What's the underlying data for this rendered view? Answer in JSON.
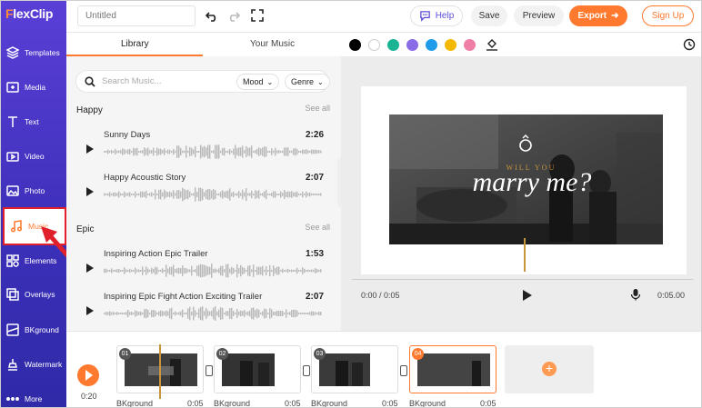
{
  "app": {
    "logo_pre": "F",
    "logo_rest": "lexClip"
  },
  "sidebar": {
    "items": [
      {
        "label": "Templates",
        "icon": "templates-icon"
      },
      {
        "label": "Media",
        "icon": "media-icon"
      },
      {
        "label": "Text",
        "icon": "text-icon"
      },
      {
        "label": "Video",
        "icon": "video-icon"
      },
      {
        "label": "Photo",
        "icon": "photo-icon"
      },
      {
        "label": "Music",
        "icon": "music-icon"
      },
      {
        "label": "Elements",
        "icon": "elements-icon"
      },
      {
        "label": "Overlays",
        "icon": "overlays-icon"
      },
      {
        "label": "BKground",
        "icon": "background-icon"
      },
      {
        "label": "Watermark",
        "icon": "watermark-icon"
      },
      {
        "label": "More",
        "icon": "more-icon"
      }
    ],
    "active": "Music"
  },
  "topbar": {
    "title_placeholder": "Untitled",
    "help": "Help",
    "save": "Save",
    "preview": "Preview",
    "export": "Export",
    "signup": "Sign Up"
  },
  "library": {
    "tabs": [
      "Library",
      "Your Music"
    ],
    "search_placeholder": "Search Music...",
    "mood": "Mood",
    "genre": "Genre",
    "sections": [
      {
        "title": "Happy",
        "see_all": "See all",
        "tracks": [
          {
            "name": "Sunny Days",
            "duration": "2:26"
          },
          {
            "name": "Happy Acoustic Story",
            "duration": "2:07"
          }
        ]
      },
      {
        "title": "Epic",
        "see_all": "See all",
        "tracks": [
          {
            "name": "Inspiring Action Epic Trailer",
            "duration": "1:53"
          },
          {
            "name": "Inspiring Epic Fight Action Exciting Trailer",
            "duration": "2:07"
          }
        ]
      }
    ]
  },
  "colors": [
    "#000000",
    "#ffffff",
    "#1ab394",
    "#8a6be8",
    "#1e9be9",
    "#f5b800",
    "#f07fa8"
  ],
  "canvas": {
    "overlay_small": "WILL YOU",
    "overlay_big": "marry me?",
    "time_current": "0:00 / 0:05",
    "time_total": "0:05.00"
  },
  "timeline": {
    "time": "0:20",
    "clips": [
      {
        "num": "01",
        "label": "BKground",
        "duration": "0:05"
      },
      {
        "num": "02",
        "label": "BKground",
        "duration": "0:05"
      },
      {
        "num": "03",
        "label": "BKground",
        "duration": "0:05"
      },
      {
        "num": "04",
        "label": "BKground",
        "duration": "0:05"
      }
    ]
  }
}
